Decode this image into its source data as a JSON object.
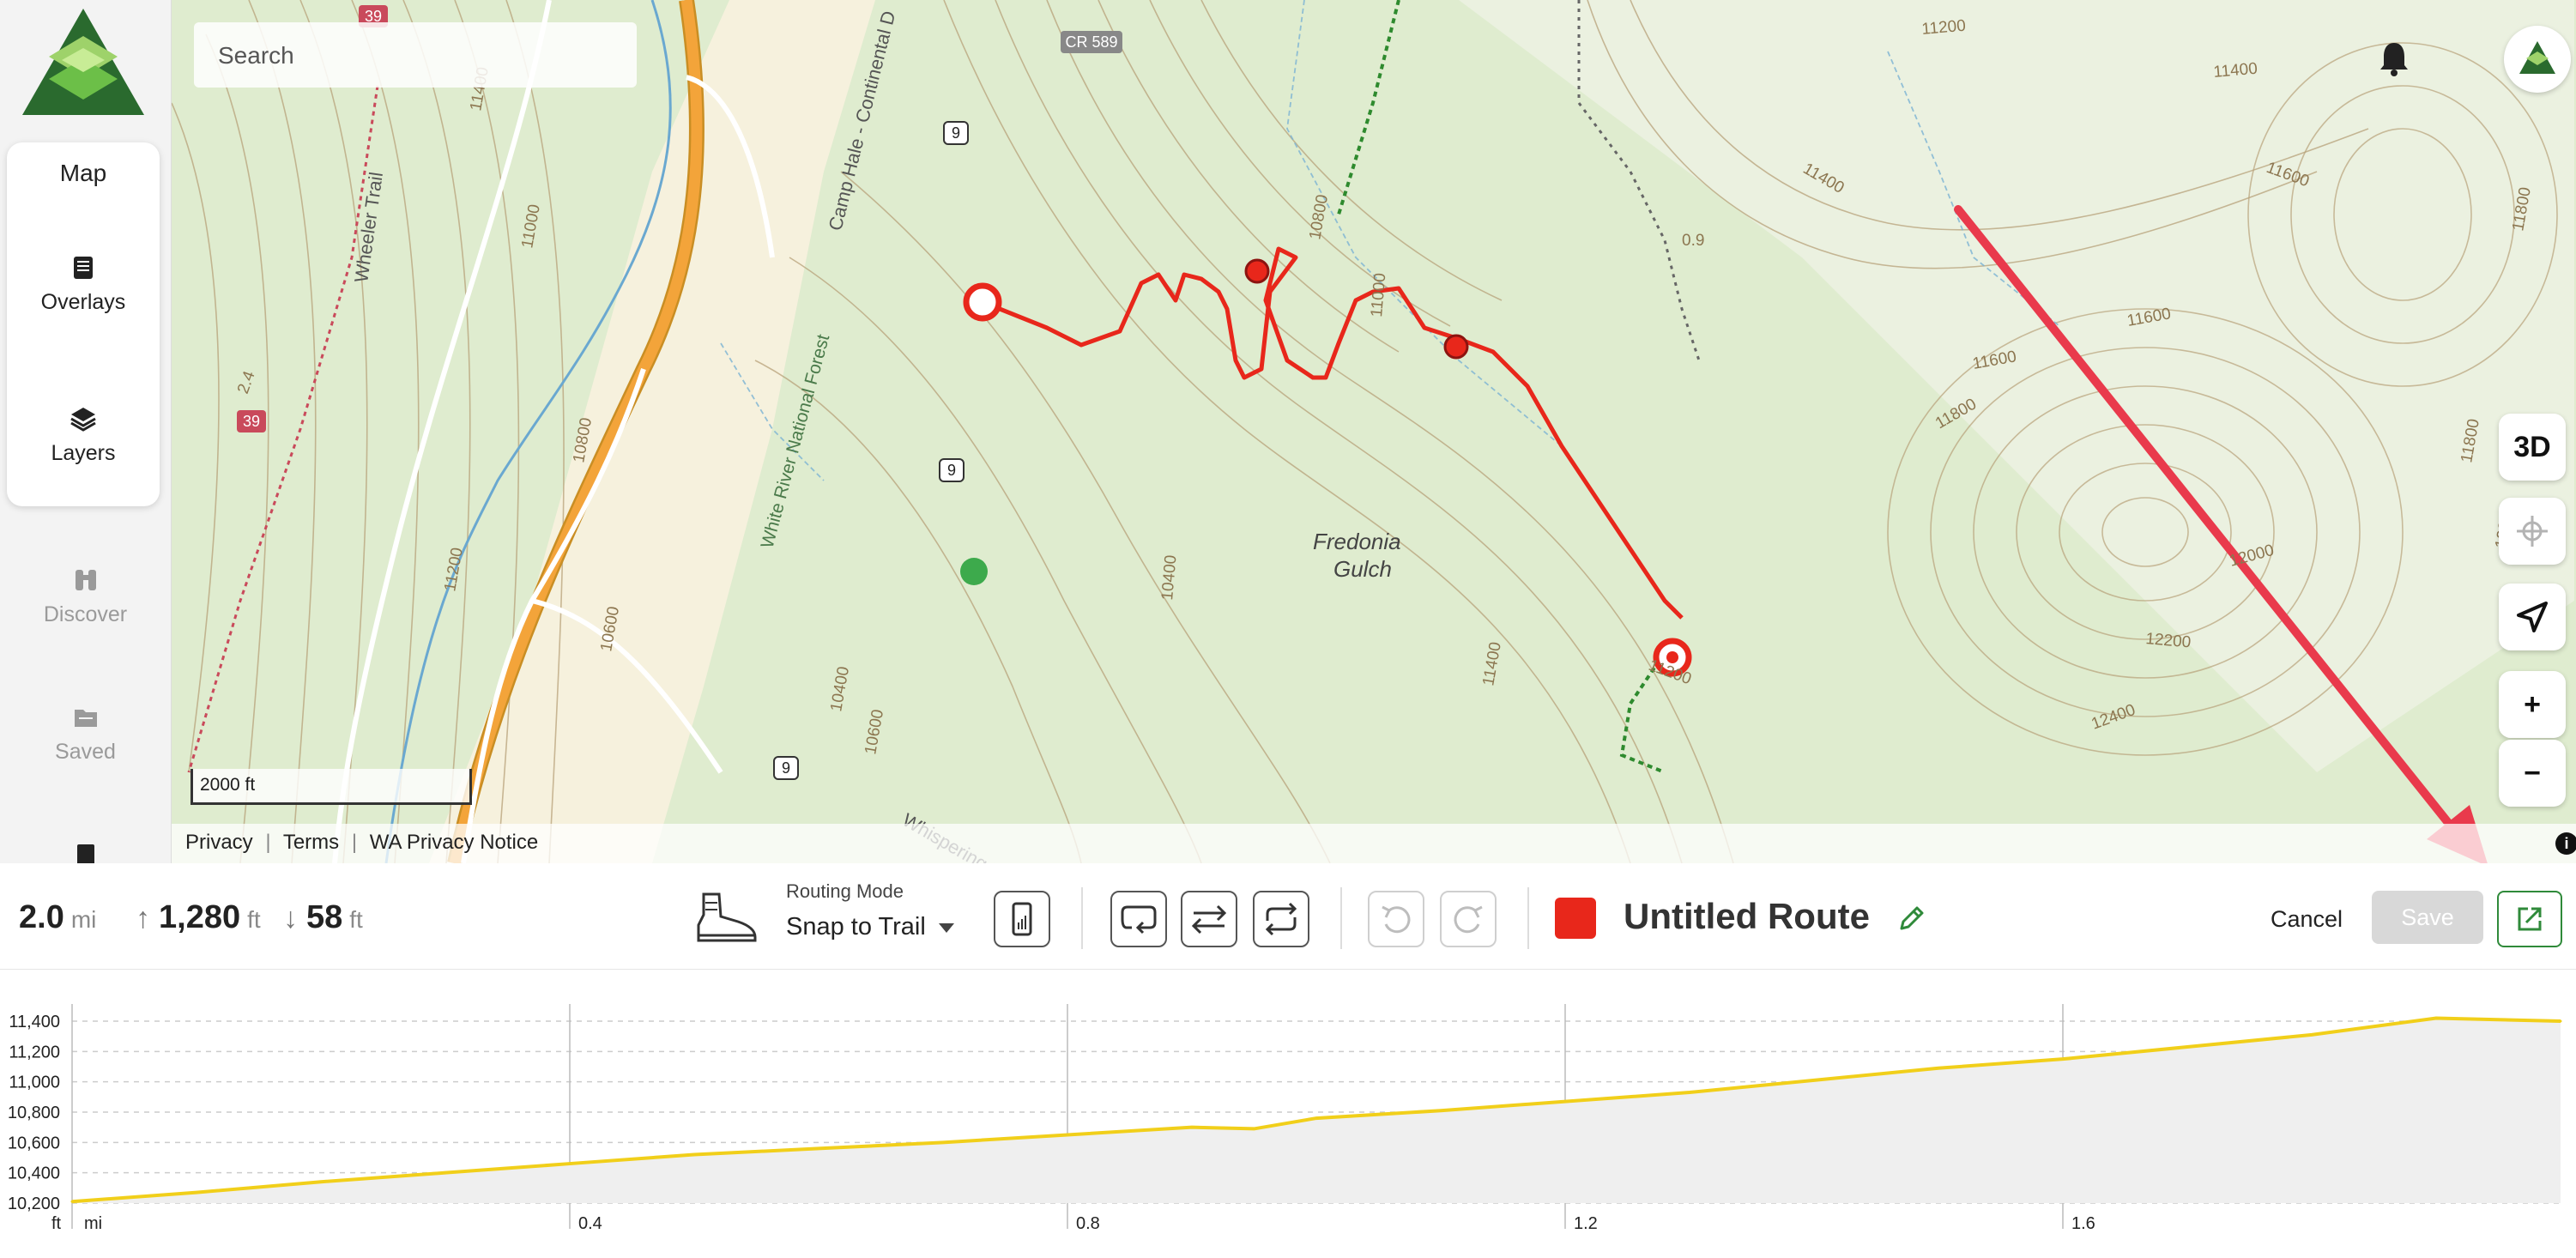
{
  "sidebar": {
    "items": [
      {
        "label": "Map",
        "icon": "map-icon"
      },
      {
        "label": "Overlays",
        "icon": "overlays-icon"
      },
      {
        "label": "Layers",
        "icon": "layers-icon"
      },
      {
        "label": "Discover",
        "icon": "binoculars-icon"
      },
      {
        "label": "Saved",
        "icon": "folder-icon"
      }
    ]
  },
  "map": {
    "search_placeholder": "Search",
    "btn_3d": "3D",
    "zoom_in": "+",
    "zoom_out": "−",
    "scale_label": "2000 ft",
    "legal": {
      "privacy": "Privacy",
      "terms": "Terms",
      "wa_privacy": "WA Privacy Notice"
    },
    "info": "i",
    "place_label_1": "Fredonia",
    "place_label_2": "Gulch",
    "road_labels": [
      "CR 589",
      "9",
      "9",
      "9",
      "39",
      "39"
    ],
    "area_label": "White River National Forest",
    "trail_label": "Wheeler Trail",
    "street_label": "Whispering Pine Circle",
    "camp_label": "Camp Hale - Continental D",
    "contour_labels": [
      "11400",
      "11600",
      "11800",
      "11000",
      "10800",
      "10600",
      "10400",
      "11200",
      "11400",
      "11600",
      "11800",
      "12000",
      "12200",
      "12400",
      "11200",
      "11400",
      "11600",
      "11800",
      "12000",
      "10400",
      "10600",
      "10800",
      "11000",
      "11200",
      "11400"
    ],
    "trail_distance": "0.9",
    "wheeler_distance": "2.4"
  },
  "stats": {
    "distance": "2.0",
    "distance_unit": "mi",
    "gain": "1,280",
    "gain_unit": "ft",
    "loss": "58",
    "loss_unit": "ft"
  },
  "routing": {
    "label": "Routing Mode",
    "value": "Snap to Trail"
  },
  "route": {
    "name": "Untitled Route",
    "color": "#e8271b"
  },
  "actions": {
    "cancel": "Cancel",
    "save": "Save"
  },
  "chart_data": {
    "type": "area",
    "x_unit": "mi",
    "y_unit": "ft",
    "x_ticks": [
      "0.4",
      "0.8",
      "1.2",
      "1.6"
    ],
    "y_ticks": [
      "11,400",
      "11,200",
      "11,000",
      "10,800",
      "10,600",
      "10,400",
      "10,200"
    ],
    "ylim": [
      10200,
      11400
    ],
    "xlim": [
      0,
      2.0
    ],
    "x": [
      0,
      0.1,
      0.2,
      0.3,
      0.4,
      0.5,
      0.6,
      0.7,
      0.8,
      0.9,
      0.95,
      1.0,
      1.1,
      1.2,
      1.3,
      1.4,
      1.5,
      1.6,
      1.7,
      1.8,
      1.9,
      2.0
    ],
    "y": [
      10210,
      10270,
      10340,
      10400,
      10460,
      10520,
      10560,
      10600,
      10650,
      10700,
      10690,
      10760,
      10810,
      10870,
      10930,
      11010,
      11090,
      11150,
      11230,
      11310,
      11420,
      11400
    ],
    "color": "#f1cf1a",
    "grid": true
  }
}
